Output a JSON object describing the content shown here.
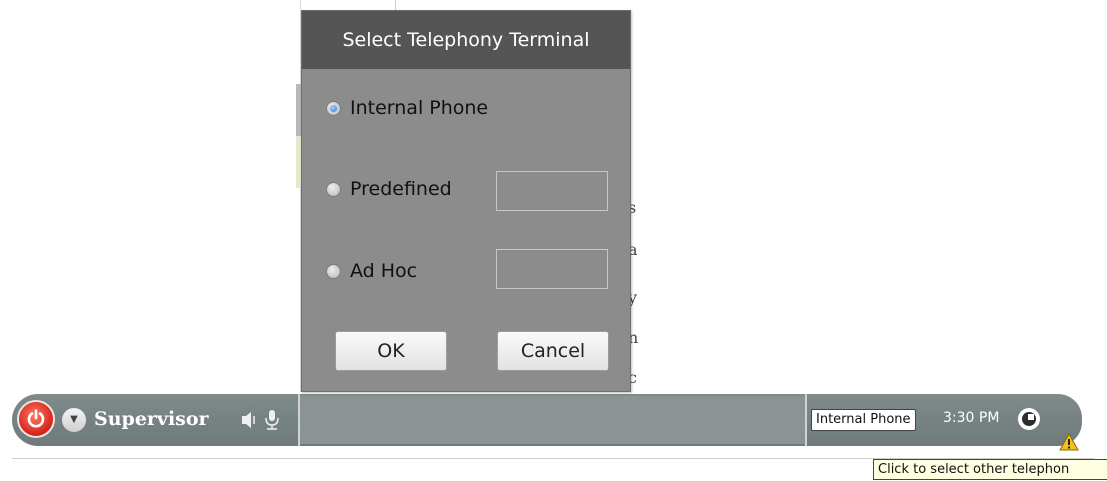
{
  "dialog": {
    "title": "Select Telephony Terminal",
    "options": [
      {
        "label": "Internal Phone",
        "selected": true
      },
      {
        "label": "Predefined",
        "selected": false,
        "value": ""
      },
      {
        "label": "Ad Hoc",
        "selected": false,
        "value": ""
      }
    ],
    "ok_label": "OK",
    "cancel_label": "Cancel"
  },
  "background": {
    "chars": [
      "s",
      "a",
      "y",
      "n",
      "c"
    ]
  },
  "taskbar": {
    "user": "Supervisor",
    "terminal": "Internal Phone",
    "time": "3:30 PM",
    "icons": [
      "power-icon",
      "chevron-down-icon",
      "speaker-icon",
      "microphone-icon",
      "status-icon",
      "warning-icon"
    ]
  },
  "tooltip": {
    "text": "Click to select other telephon"
  },
  "colors": {
    "title_bar": "#555555",
    "dialog_bg": "#8c8c8c",
    "taskbar_bg": "#7a8585",
    "power_red": "#d8281c",
    "radio_selected": "#2a76c8"
  }
}
